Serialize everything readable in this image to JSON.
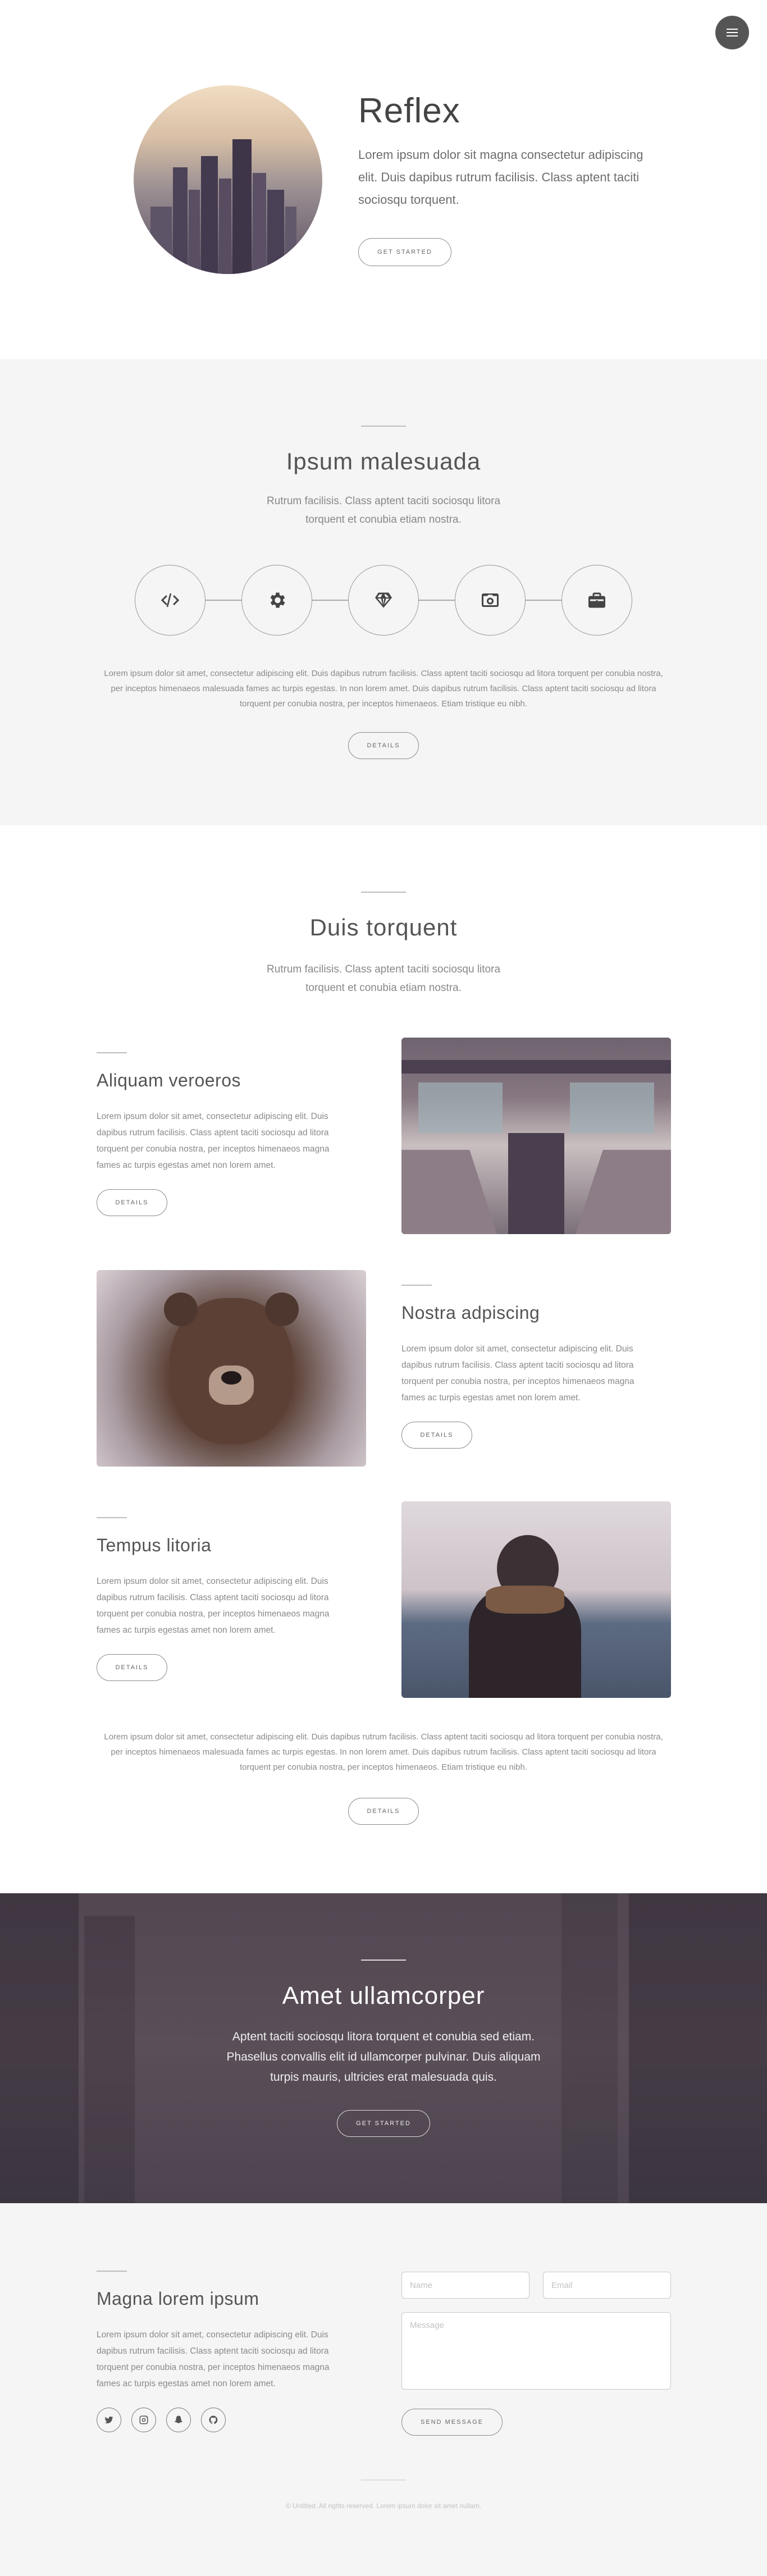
{
  "header": {
    "menu_icon": "menu-icon"
  },
  "hero": {
    "title": "Reflex",
    "subtitle": "Lorem ipsum dolor sit magna consectetur adipiscing elit. Duis dapibus rutrum facilisis. Class aptent taciti sociosqu torquent.",
    "button_label": "GET STARTED",
    "image_icon": "city-skyline-image"
  },
  "section2": {
    "title": "Ipsum malesuada",
    "subtitle": "Rutrum facilisis. Class aptent taciti sociosqu litora torquent et conubia etiam nostra.",
    "icons": [
      "code-icon",
      "gear-icon",
      "diamond-icon",
      "camera-icon",
      "briefcase-icon"
    ],
    "paragraph": "Lorem ipsum dolor sit amet, consectetur adipiscing elit. Duis dapibus rutrum facilisis. Class aptent taciti sociosqu ad litora torquent per conubia nostra, per inceptos himenaeos malesuada fames ac turpis egestas. In non lorem amet. Duis dapibus rutrum facilisis. Class aptent taciti sociosqu ad litora torquent per conubia nostra, per inceptos himenaeos. Etiam tristique eu nibh.",
    "button_label": "DETAILS"
  },
  "section3": {
    "title": "Duis torquent",
    "subtitle": "Rutrum facilisis. Class aptent taciti sociosqu litora torquent et conubia etiam nostra.",
    "features": [
      {
        "title": "Aliquam veroeros",
        "text": "Lorem ipsum dolor sit amet, consectetur adipiscing elit. Duis dapibus rutrum facilisis. Class aptent taciti sociosqu ad litora torquent per conubia nostra, per inceptos himenaeos magna fames ac turpis egestas amet non lorem amet.",
        "button_label": "DETAILS",
        "image": "escalator-image"
      },
      {
        "title": "Nostra adpiscing",
        "text": "Lorem ipsum dolor sit amet, consectetur adipiscing elit. Duis dapibus rutrum facilisis. Class aptent taciti sociosqu ad litora torquent per conubia nostra, per inceptos himenaeos magna fames ac turpis egestas amet non lorem amet.",
        "button_label": "DETAILS",
        "image": "bear-image"
      },
      {
        "title": "Tempus litoria",
        "text": "Lorem ipsum dolor sit amet, consectetur adipiscing elit. Duis dapibus rutrum facilisis. Class aptent taciti sociosqu ad litora torquent per conubia nostra, per inceptos himenaeos magna fames ac turpis egestas amet non lorem amet.",
        "button_label": "DETAILS",
        "image": "person-at-sea-image"
      }
    ],
    "paragraph": "Lorem ipsum dolor sit amet, consectetur adipiscing elit. Duis dapibus rutrum facilisis. Class aptent taciti sociosqu ad litora torquent per conubia nostra, per inceptos himenaeos malesuada fames ac turpis egestas. In non lorem amet. Duis dapibus rutrum facilisis. Class aptent taciti sociosqu ad litora torquent per conubia nostra, per inceptos himenaeos. Etiam tristique eu nibh.",
    "button_label": "DETAILS"
  },
  "cta": {
    "title": "Amet ullamcorper",
    "text": "Aptent taciti sociosqu litora torquent et conubia sed etiam. Phasellus convallis elit id ullamcorper pulvinar. Duis aliquam turpis mauris, ultricies erat malesuada quis.",
    "button_label": "GET STARTED"
  },
  "contact": {
    "title": "Magna lorem ipsum",
    "text": "Lorem ipsum dolor sit amet, consectetur adipiscing elit. Duis dapibus rutrum facilisis. Class aptent taciti sociosqu ad litora torquent per conubia nostra, per inceptos himenaeos magna fames ac turpis egestas amet non lorem amet.",
    "social": [
      "twitter-icon",
      "instagram-icon",
      "snapchat-icon",
      "github-icon"
    ],
    "name_placeholder": "Name",
    "email_placeholder": "Email",
    "message_placeholder": "Message",
    "send_label": "SEND MESSAGE"
  },
  "footer": {
    "copyright": "© Untitled. All rights reserved. Lorem ipsum dolor sit amet nullam."
  }
}
